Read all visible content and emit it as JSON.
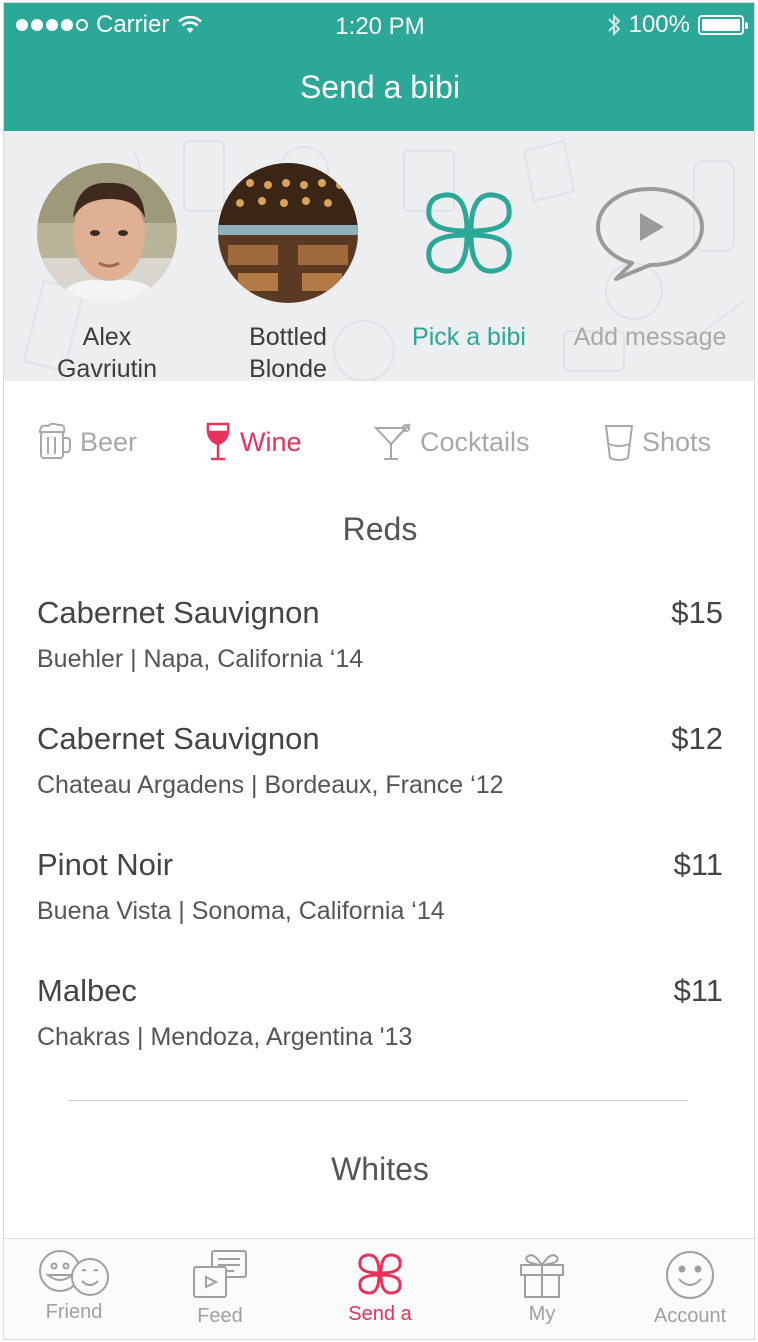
{
  "status_bar": {
    "carrier": "Carrier",
    "time": "1:20 PM",
    "battery": "100%"
  },
  "nav": {
    "title": "Send a bibi"
  },
  "recipients": [
    {
      "label_line1": "Alex",
      "label_line2": "Gavriutin"
    },
    {
      "label_line1": "Bottled",
      "label_line2": "Blonde"
    }
  ],
  "actions": {
    "pick": "Pick a bibi",
    "message": "Add message"
  },
  "categories": [
    {
      "label": "Beer",
      "icon": "beer-mug-icon",
      "active": false
    },
    {
      "label": "Wine",
      "icon": "wine-glass-icon",
      "active": true
    },
    {
      "label": "Cocktails",
      "icon": "cocktail-glass-icon",
      "active": false
    },
    {
      "label": "Shots",
      "icon": "shot-glass-icon",
      "active": false
    }
  ],
  "sections": {
    "reds": "Reds",
    "whites": "Whites"
  },
  "reds": [
    {
      "name": "Cabernet Sauvignon",
      "price": "$15",
      "details": "Buehler | Napa, California ‘14"
    },
    {
      "name": "Cabernet Sauvignon",
      "price": "$12",
      "details": "Chateau Argadens | Bordeaux, France ‘12"
    },
    {
      "name": "Pinot Noir",
      "price": "$11",
      "details": "Buena Vista | Sonoma, California ‘14"
    },
    {
      "name": "Malbec",
      "price": "$11",
      "details": "Chakras | Mendoza, Argentina '13"
    }
  ],
  "tabbar": {
    "friend": "Friend",
    "feed": "Feed",
    "send": "Send a",
    "my": "My",
    "account": "Account"
  },
  "colors": {
    "brand_teal": "#2ba897",
    "accent_red": "#e8315b"
  }
}
